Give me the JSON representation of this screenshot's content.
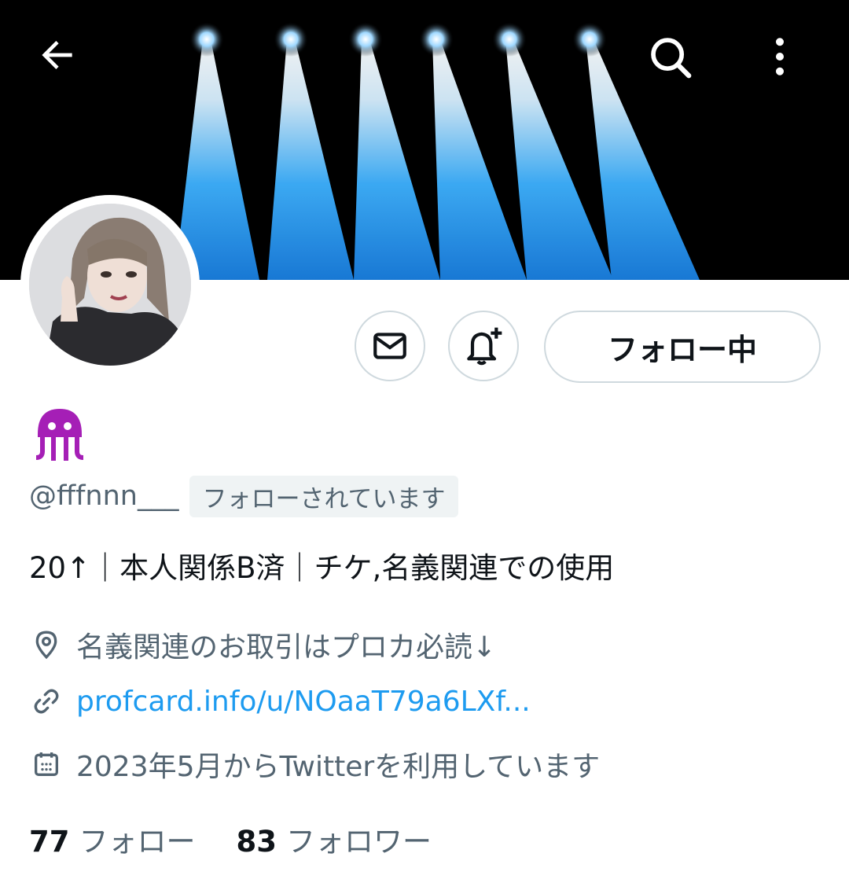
{
  "header": {
    "back_icon": "arrow-left-icon",
    "search_icon": "search-icon",
    "more_icon": "more-vertical-icon"
  },
  "banner": {
    "description_colors": {
      "background": "#000000",
      "beam": "#1fa2ff"
    }
  },
  "profile": {
    "display_name_emoji": "jellyfish-emoji-icon",
    "emoji_color": "#a51fb6",
    "handle": "@fffnnn___",
    "follows_you_label": "フォローされています",
    "bio": "20↑｜本人関係B済｜チケ,名義関連での使用",
    "location": "名義関連のお取引はプロカ必読↓",
    "website": "profcard.info/u/NOaaT79a6LXf...",
    "joined": "2023年5月からTwitterを利用しています"
  },
  "actions": {
    "dm_icon": "envelope-icon",
    "notify_icon": "bell-plus-icon",
    "follow_label": "フォロー中"
  },
  "stats": {
    "following_count": "77",
    "following_label": "フォロー",
    "followers_count": "83",
    "followers_label": "フォロワー"
  },
  "colors": {
    "primary_text": "#0f1419",
    "secondary_text": "#536471",
    "link": "#1d9bf0",
    "border": "#cfd9de"
  }
}
